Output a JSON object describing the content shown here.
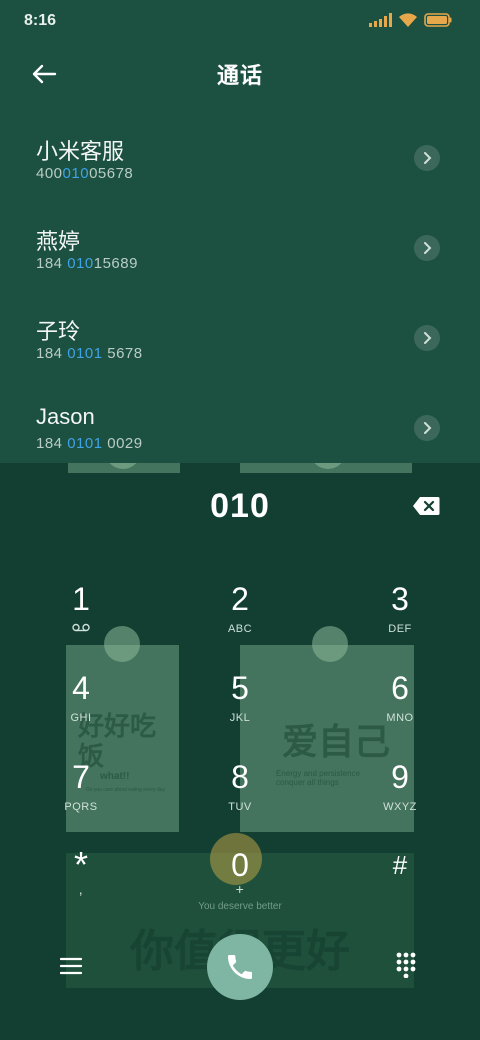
{
  "status_bar": {
    "time": "8:16",
    "battery_color": "#e6a84a"
  },
  "header": {
    "title": "通话",
    "back_icon": "arrow-left-icon"
  },
  "contacts": [
    {
      "name": "小米客服",
      "number_pre": "400",
      "number_hl": "010",
      "number_post": "05678"
    },
    {
      "name": "燕婷",
      "number_pre": "184 ",
      "number_hl": "010",
      "number_post": "15689"
    },
    {
      "name": "子玲",
      "number_pre": "184 ",
      "number_hl": "0101",
      "number_post": " 5678"
    },
    {
      "name": "Jason",
      "number_pre": "184 ",
      "number_hl": "0101",
      "number_post": " 0029"
    }
  ],
  "dialer": {
    "display": "010",
    "keys": [
      {
        "digit": "1",
        "letters": "voicemail"
      },
      {
        "digit": "2",
        "letters": "ABC"
      },
      {
        "digit": "3",
        "letters": "DEF"
      },
      {
        "digit": "4",
        "letters": "GHI"
      },
      {
        "digit": "5",
        "letters": "JKL"
      },
      {
        "digit": "6",
        "letters": "MNO"
      },
      {
        "digit": "7",
        "letters": "PQRS"
      },
      {
        "digit": "8",
        "letters": "TUV"
      },
      {
        "digit": "9",
        "letters": "WXYZ"
      },
      {
        "digit": "*",
        "letters": ","
      },
      {
        "digit": "0",
        "letters": "+"
      },
      {
        "digit": "#",
        "letters": ""
      }
    ]
  },
  "wallpaper": {
    "card1_text": "好好吃饭",
    "card1_sub": "what!!",
    "card1_small": "Do you care about eating every day",
    "card2_text": "爱自己",
    "card2_sub": "Energy and persistence conquer all things",
    "card3_top": "You deserve better",
    "card3_text": "你值得更好"
  },
  "colors": {
    "background": "#1c5040",
    "dial_panel": "#123f32",
    "highlight": "#3fa3e6",
    "call_button": "#7fb5a3"
  }
}
